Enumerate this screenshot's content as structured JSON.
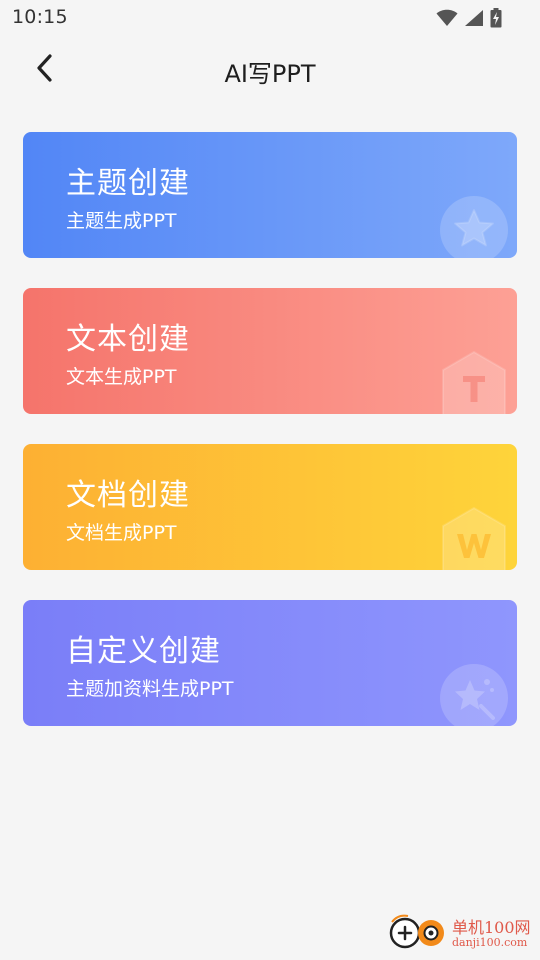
{
  "status_bar": {
    "time": "10:15",
    "icons": [
      "wifi-icon",
      "signal-icon",
      "battery-charging-icon"
    ]
  },
  "nav": {
    "title": "AI写PPT",
    "back_icon": "back-arrow-icon"
  },
  "cards": [
    {
      "title": "主题创建",
      "subtitle": "主题生成PPT",
      "icon": "star-icon",
      "color_start": "#5286f6",
      "color_end": "#7ea8fa"
    },
    {
      "title": "文本创建",
      "subtitle": "文本生成PPT",
      "icon": "text-t-icon",
      "color_start": "#f5746b",
      "color_end": "#fda095"
    },
    {
      "title": "文档创建",
      "subtitle": "文档生成PPT",
      "icon": "word-doc-icon",
      "color_start": "#fdb033",
      "color_end": "#fed43a"
    },
    {
      "title": "自定义创建",
      "subtitle": "主题加资料生成PPT",
      "icon": "magic-star-icon",
      "color_start": "#7a7ef8",
      "color_end": "#8f96fd"
    }
  ],
  "watermark": {
    "name": "单机100网",
    "url": "danji100.com",
    "accent": "#e0594a"
  }
}
